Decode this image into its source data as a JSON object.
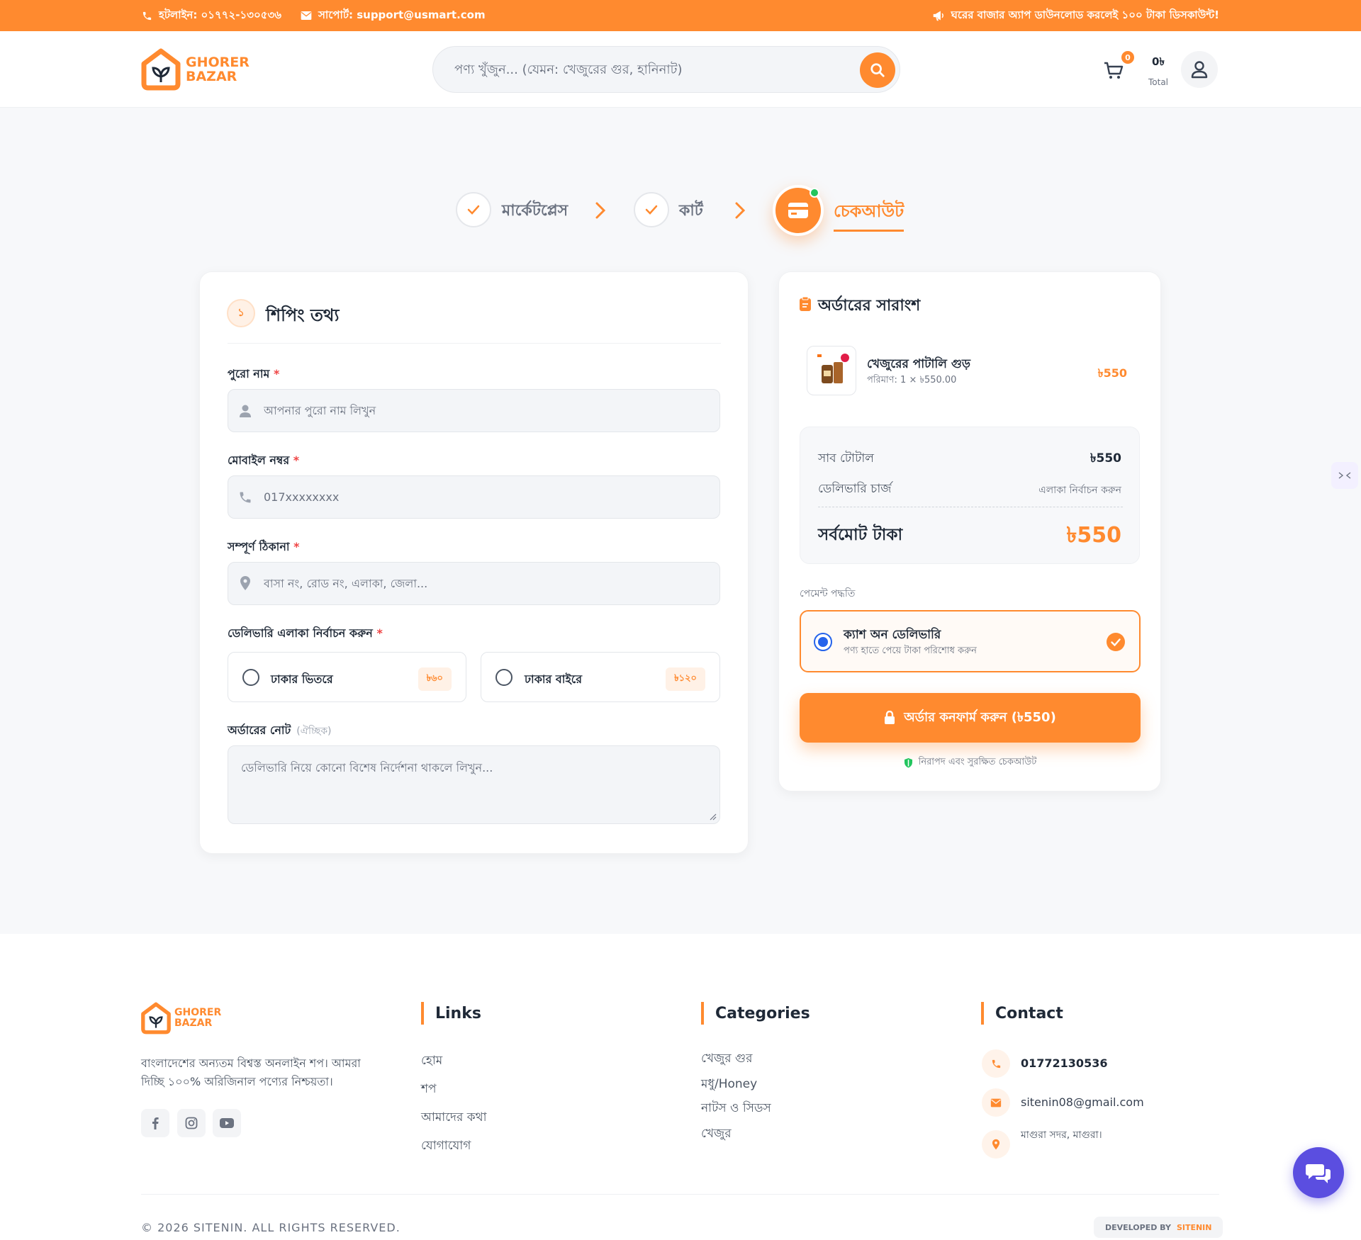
{
  "topbar": {
    "hotline": "হটলাইন: ০১৭৭২-১৩০৫৩৬",
    "support": "সাপোর্ট: support@usmart.com",
    "promo": "ঘরের বাজার অ্যাপ ডাউনলোড করলেই ১০০ টাকা ডিসকাউন্ট!"
  },
  "brand": {
    "line1": "GHORER",
    "line2": "BAZAR",
    "color": "#ff8a2f"
  },
  "search": {
    "placeholder": "পণ্য খুঁজুন... (যেমন: খেজুরের গুর, হানিনাট)"
  },
  "cart": {
    "count": "0",
    "amount": "0৳",
    "total_label": "Total"
  },
  "steps": [
    {
      "label": "মার্কেটপ্লেস",
      "done": true
    },
    {
      "label": "কার্ট",
      "done": true
    },
    {
      "label": "চেকআউট",
      "active": true
    }
  ],
  "shipping": {
    "step_no": "১",
    "title": "শিপিং তথ্য",
    "name_label": "পুরো নাম",
    "name_placeholder": "আপনার পুরো নাম লিখুন",
    "mobile_label": "মোবাইল নম্বর",
    "mobile_placeholder": "017xxxxxxxx",
    "address_label": "সম্পূর্ণ ঠিকানা",
    "address_placeholder": "বাসা নং, রোড নং, এলাকা, জেলা...",
    "area_label": "ডেলিভারি এলাকা নির্বাচন করুন",
    "required_mark": "*",
    "areas": [
      {
        "name": "ঢাকার ভিতরে",
        "fee": "৳৬০"
      },
      {
        "name": "ঢাকার বাইরে",
        "fee": "৳১২০"
      }
    ],
    "note_label": "অর্ডারের নোট",
    "note_optional": "(ঐচ্ছিক)",
    "note_placeholder": "ডেলিভারি নিয়ে কোনো বিশেষ নির্দেশনা থাকলে লিখুন..."
  },
  "summary": {
    "title": "অর্ডারের সারাংশ",
    "item": {
      "name": "খেজুরের পাটালি গুড়",
      "qty": "পরিমাণ: 1 × ৳550.00",
      "price": "৳550"
    },
    "subtotal_label": "সাব টোটাল",
    "subtotal": "৳550",
    "delivery_label": "ডেলিভারি চার্জ",
    "delivery_value": "এলাকা নির্বাচন করুন",
    "total_label": "সর্বমোট টাকা",
    "total": "৳550",
    "payment_label": "পেমেন্ট পদ্ধতি",
    "payment_method": "ক্যাশ অন ডেলিভারি",
    "payment_desc": "পণ্য হাতে পেয়ে টাকা পরিশোধ করুন",
    "confirm_button": "অর্ডার কনফার্ম করুন (৳550)",
    "secure_note": "নিরাপদ এবং সুরক্ষিত চেকআউট"
  },
  "footer": {
    "about": "বাংলাদেশের অন্যতম বিশ্বস্ত অনলাইন শপ। আমরা দিচ্ছি ১০০% অরিজিনাল পণ্যের নিশ্চয়তা।",
    "links_title": "Links",
    "links": [
      "হোম",
      "শপ",
      "আমাদের কথা",
      "যোগাযোগ"
    ],
    "categories_title": "Categories",
    "categories": [
      "খেজুর গুর",
      "মধু/Honey",
      "নাটস ও সিডস",
      "খেজুর"
    ],
    "contact_title": "Contact",
    "phone": "01772130536",
    "email": "sitenin08@gmail.com",
    "address": "মাগুরা সদর, মাগুরা।",
    "copyright": "© 2026 SITENIN. ALL RIGHTS RESERVED.",
    "developed_by": "DEVELOPED BY",
    "developer": "SITENIN"
  },
  "colors": {
    "accent": "#ff8a2f",
    "chat": "#5b4ee0",
    "success": "#22c55e"
  }
}
